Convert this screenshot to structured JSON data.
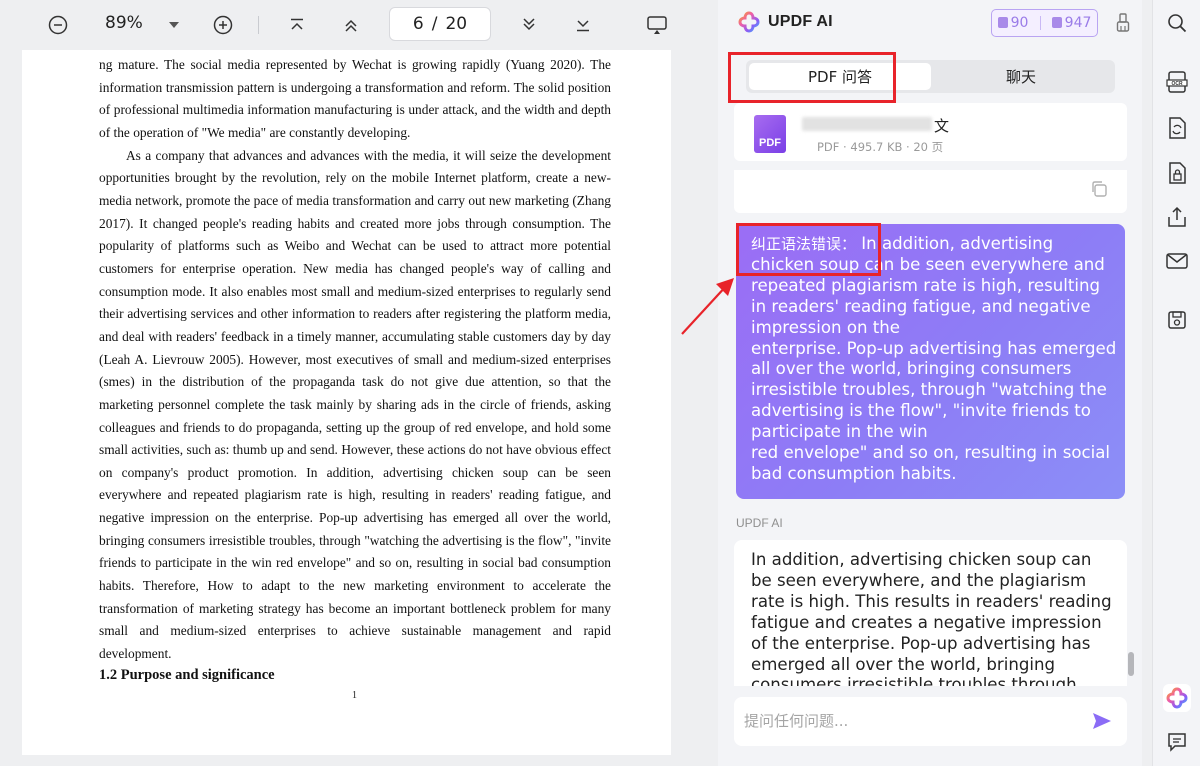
{
  "toolbar": {
    "zoom": "89%",
    "current_page": "6",
    "page_sep": "/",
    "total_pages": "20"
  },
  "document": {
    "paragraphs": [
      "ng mature. The social media represented by Wechat is growing rapidly (Yuang 2020). The information transmission pattern is undergoing a transformation and reform. The solid position of professional multimedia information manufacturing is under attack, and the width and depth of the operation of \"We media\" are constantly developing.",
      "As a company that advances and advances with the media, it will seize the development opportunities brought by the revolution, rely on the mobile Internet platform, create a new-media network, promote the pace of media transformation and carry out new marketing (Zhang 2017). It changed people's reading habits and created more jobs through consumption. The popularity of platforms such as Weibo and Wechat can be used to attract more potential customers for enterprise operation. New media has changed people's way of calling and consumption mode. It also enables most small and medium-sized enterprises to regularly send their advertising services and other information to readers after registering the platform media, and deal with readers' feedback in a timely manner, accumulating stable customers day by day (Leah A. Lievrouw 2005). However, most executives of small and medium-sized enterprises (smes) in the distribution of the propaganda task do not give due attention, so that the marketing personnel complete the task mainly by sharing ads in the circle of friends, asking colleagues and friends to do propaganda, setting up the group of red envelope, and hold some small activities, such as: thumb up and send. However, these actions do not have obvious effect on company's product promotion. In addition, advertising chicken soup can be seen everywhere and repeated plagiarism rate is high, resulting in readers' reading fatigue, and negative impression on the enterprise. Pop-up advertising has emerged all over the world, bringing consumers irresistible troubles, through \"watching the advertising is the flow\", \"invite friends to participate in the win red envelope\" and so on, resulting in social bad consumption habits. Therefore, How to adapt to the new marketing environment to accelerate the transformation of marketing strategy has become an important bottleneck problem for many small and medium-sized enterprises to achieve sustainable management and rapid development."
    ],
    "heading": "1.2 Purpose and significance",
    "page_number": "1"
  },
  "ai_panel": {
    "title": "UPDF AI",
    "credits_a": "90",
    "credits_b": "947",
    "tabs": [
      {
        "label": "PDF 问答"
      },
      {
        "label": "聊天"
      }
    ],
    "file": {
      "name_tail": "文",
      "meta": "PDF · 495.7 KB · 20 页",
      "icon_label": "PDF"
    },
    "user_message": {
      "tag": "纠正语法错误：",
      "text": " In addition, advertising chicken soup can be seen everywhere and repeated plagiarism rate is high, resulting in readers' reading fatigue, and negative impression on the\nenterprise. Pop-up advertising has emerged all over the world, bringing consumers irresistible troubles, through \"watching the advertising is the flow\", \"invite friends to participate in the win\nred envelope\" and so on, resulting in social bad consumption habits."
    },
    "ai_label": "UPDF AI",
    "ai_message": "In addition, advertising chicken soup can be seen everywhere, and the plagiarism rate is high. This results in readers' reading fatigue and creates a negative impression of the enterprise. Pop-up advertising has emerged all over the world, bringing consumers irresistible troubles through tactics such as \"watching the",
    "input_placeholder": "提问任何问题..."
  },
  "colors": {
    "accent": "#8b6cf6",
    "annotation_red": "#e8232a"
  },
  "icons": {
    "toolbar": [
      "zoom-out-icon",
      "dropdown-icon",
      "zoom-in-icon",
      "first-page-icon",
      "prev-page-icon",
      "next-page-icon",
      "last-page-icon",
      "presentation-icon"
    ],
    "rail": [
      "search-icon",
      "ocr-icon",
      "convert-icon",
      "protect-icon",
      "share-icon",
      "email-icon",
      "save-icon",
      "updf-ai-icon",
      "comment-icon"
    ]
  }
}
